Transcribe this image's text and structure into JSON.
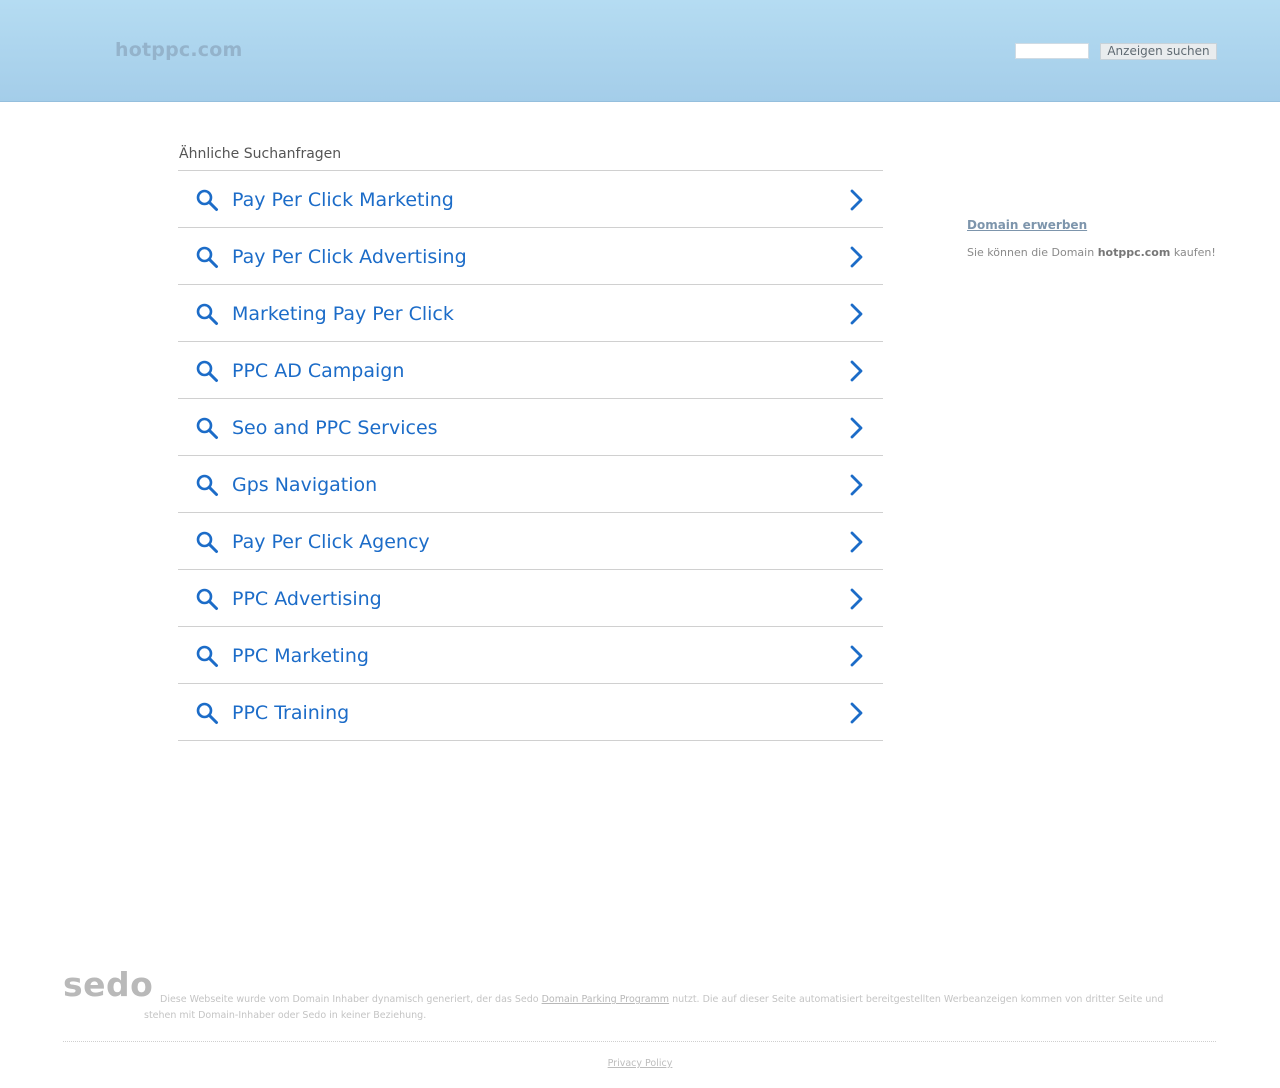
{
  "header": {
    "site_name": "hotppc.com",
    "search_placeholder": "",
    "search_button": "Anzeigen suchen"
  },
  "related": {
    "title": "Ähnliche Suchanfragen",
    "items": [
      {
        "label": "Pay Per Click Marketing"
      },
      {
        "label": "Pay Per Click Advertising"
      },
      {
        "label": "Marketing Pay Per Click"
      },
      {
        "label": "PPC AD Campaign"
      },
      {
        "label": "Seo and PPC Services"
      },
      {
        "label": "Gps Navigation"
      },
      {
        "label": "Pay Per Click Agency"
      },
      {
        "label": "PPC Advertising"
      },
      {
        "label": "PPC Marketing"
      },
      {
        "label": "PPC Training"
      }
    ]
  },
  "sidebar": {
    "buy_link": "Domain erwerben",
    "text_before": "Sie können die Domain ",
    "domain": "hotppc.com",
    "text_after": " kaufen!"
  },
  "footer": {
    "logo": "sedo",
    "disclaimer_part1": "Diese Webseite wurde vom Domain Inhaber dynamisch generiert, der das Sedo ",
    "disclaimer_link": "Domain Parking Programm",
    "disclaimer_part2": " nutzt. Die auf dieser Seite automatisiert bereitgestellten Werbeanzeigen kommen von dritter Seite und stehen mit Domain-Inhaber oder Sedo in keiner Beziehung.",
    "privacy": "Privacy Policy"
  },
  "colors": {
    "link_blue": "#1c6cc8",
    "header_top": "#b5dcf2",
    "header_bottom": "#a4cde9"
  },
  "icons": {
    "item_leading": "search-icon",
    "item_trailing": "chevron-right-icon"
  }
}
